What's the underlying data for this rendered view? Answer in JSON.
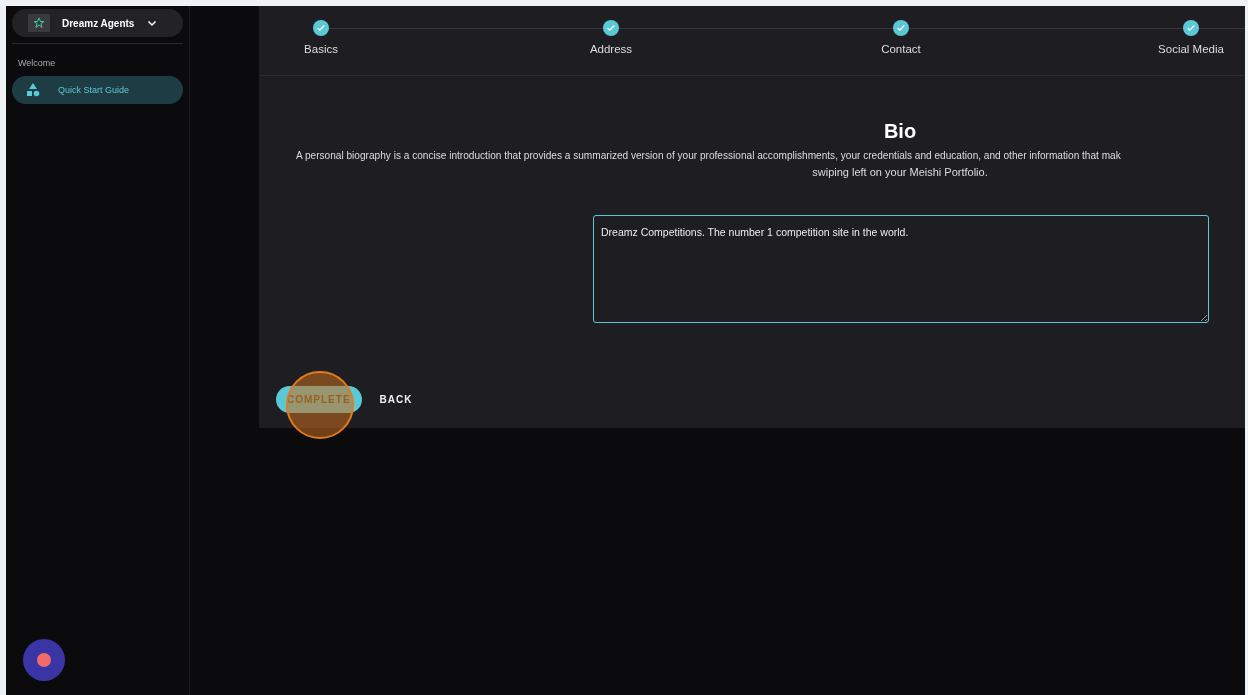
{
  "sidebar": {
    "workspace": {
      "name": "Dreamz Agents"
    },
    "section": "Welcome",
    "items": [
      {
        "label": "Quick Start Guide",
        "selected": true
      }
    ]
  },
  "stepper": {
    "steps": [
      {
        "label": "Basics",
        "done": true
      },
      {
        "label": "Address",
        "done": true
      },
      {
        "label": "Contact",
        "done": true
      },
      {
        "label": "Social Media",
        "done": true
      }
    ]
  },
  "bio": {
    "title": "Bio",
    "description_lines": [
      "A personal biography is a concise introduction that provides a summarized version of your professional accomplishments, your credentials and education, and other information that mak",
      "swiping left on your Meishi Portfolio."
    ],
    "value": "Dreamz Competitions. The number 1 competition site in the world."
  },
  "buttons": {
    "complete": "COMPLETE",
    "back": "BACK"
  }
}
